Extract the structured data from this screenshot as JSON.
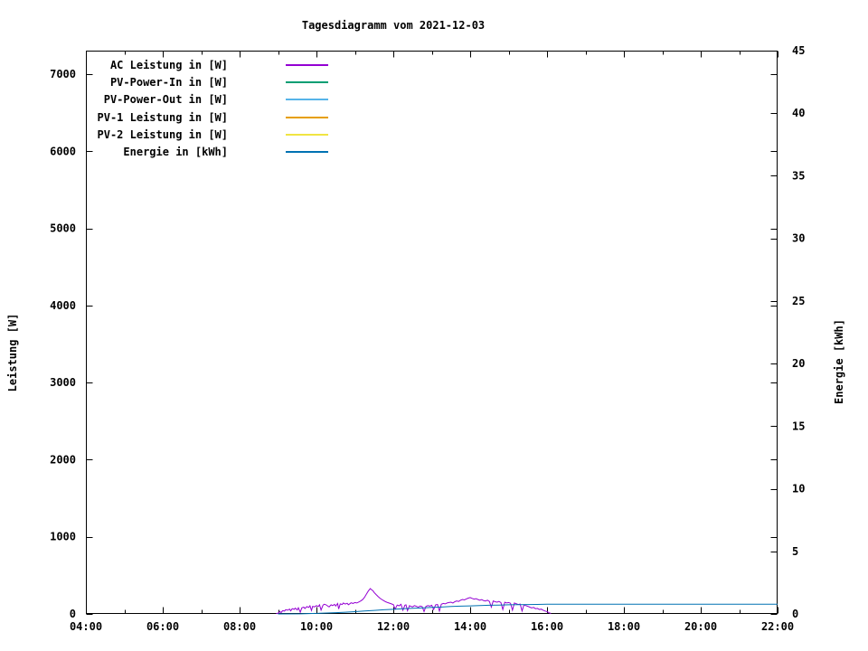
{
  "chart_data": {
    "type": "line",
    "title": "Tagesdiagramm vom 2021-12-03",
    "grid": false,
    "legend_position": "top-left-inside",
    "x_axis": {
      "range_hours": [
        4,
        22
      ],
      "major_ticks": [
        "04:00",
        "06:00",
        "08:00",
        "10:00",
        "12:00",
        "14:00",
        "16:00",
        "18:00",
        "20:00",
        "22:00"
      ],
      "minor_tick_hours": [
        5,
        7,
        9,
        11,
        13,
        15,
        17,
        19,
        21
      ]
    },
    "y_left": {
      "label": "Leistung [W]",
      "ticks": [
        0,
        1000,
        2000,
        3000,
        4000,
        5000,
        6000,
        7000
      ],
      "range": [
        0,
        7305
      ]
    },
    "y_right": {
      "label": "Energie [kWh]",
      "ticks": [
        0,
        5,
        10,
        15,
        20,
        25,
        30,
        35,
        40,
        45
      ],
      "range": [
        0,
        45
      ]
    },
    "axis_color": "#000000",
    "background_color": "#ffffff",
    "series": [
      {
        "name": "AC Leistung in [W]",
        "color": "#9400D3",
        "axis": "left",
        "points": [
          [
            8.95,
            5
          ],
          [
            9.0,
            8
          ],
          [
            9.05,
            30
          ],
          [
            9.08,
            18
          ],
          [
            9.12,
            42
          ],
          [
            9.17,
            38
          ],
          [
            9.2,
            55
          ],
          [
            9.25,
            48
          ],
          [
            9.3,
            62
          ],
          [
            9.33,
            40
          ],
          [
            9.37,
            68
          ],
          [
            9.42,
            60
          ],
          [
            9.45,
            75
          ],
          [
            9.5,
            52
          ],
          [
            9.53,
            80
          ],
          [
            9.58,
            22
          ],
          [
            9.62,
            78
          ],
          [
            9.67,
            88
          ],
          [
            9.7,
            70
          ],
          [
            9.75,
            95
          ],
          [
            9.8,
            85
          ],
          [
            9.83,
            105
          ],
          [
            9.87,
            45
          ],
          [
            9.9,
            98
          ],
          [
            9.95,
            92
          ],
          [
            10.0,
            108
          ],
          [
            10.05,
            96
          ],
          [
            10.08,
            118
          ],
          [
            10.12,
            50
          ],
          [
            10.17,
            112
          ],
          [
            10.2,
            126
          ],
          [
            10.25,
            118
          ],
          [
            10.3,
            100
          ],
          [
            10.33,
            92
          ],
          [
            10.38,
            118
          ],
          [
            10.42,
            108
          ],
          [
            10.47,
            124
          ],
          [
            10.5,
            102
          ],
          [
            10.55,
            135
          ],
          [
            10.58,
            65
          ],
          [
            10.62,
            130
          ],
          [
            10.67,
            122
          ],
          [
            10.7,
            142
          ],
          [
            10.75,
            128
          ],
          [
            10.8,
            138
          ],
          [
            10.83,
            120
          ],
          [
            10.87,
            132
          ],
          [
            10.9,
            144
          ],
          [
            10.95,
            136
          ],
          [
            11.0,
            148
          ],
          [
            11.05,
            142
          ],
          [
            11.1,
            155
          ],
          [
            11.15,
            168
          ],
          [
            11.2,
            185
          ],
          [
            11.25,
            215
          ],
          [
            11.3,
            258
          ],
          [
            11.35,
            298
          ],
          [
            11.4,
            328
          ],
          [
            11.43,
            315
          ],
          [
            11.47,
            300
          ],
          [
            11.5,
            278
          ],
          [
            11.55,
            252
          ],
          [
            11.6,
            228
          ],
          [
            11.65,
            205
          ],
          [
            11.7,
            188
          ],
          [
            11.75,
            172
          ],
          [
            11.8,
            158
          ],
          [
            11.85,
            148
          ],
          [
            11.9,
            140
          ],
          [
            11.95,
            130
          ],
          [
            12.0,
            122
          ],
          [
            12.05,
            62
          ],
          [
            12.1,
            115
          ],
          [
            12.15,
            105
          ],
          [
            12.2,
            125
          ],
          [
            12.25,
            48
          ],
          [
            12.3,
            112
          ],
          [
            12.33,
            118
          ],
          [
            12.37,
            42
          ],
          [
            12.42,
            108
          ],
          [
            12.45,
            100
          ],
          [
            12.5,
            92
          ],
          [
            12.55,
            108
          ],
          [
            12.6,
            98
          ],
          [
            12.65,
            88
          ],
          [
            12.7,
            102
          ],
          [
            12.75,
            95
          ],
          [
            12.8,
            32
          ],
          [
            12.85,
            98
          ],
          [
            12.9,
            108
          ],
          [
            12.95,
            102
          ],
          [
            13.0,
            112
          ],
          [
            13.05,
            58
          ],
          [
            13.1,
            118
          ],
          [
            13.15,
            122
          ],
          [
            13.2,
            38
          ],
          [
            13.25,
            126
          ],
          [
            13.3,
            136
          ],
          [
            13.35,
            130
          ],
          [
            13.4,
            142
          ],
          [
            13.45,
            148
          ],
          [
            13.5,
            152
          ],
          [
            13.55,
            142
          ],
          [
            13.6,
            158
          ],
          [
            13.65,
            168
          ],
          [
            13.7,
            162
          ],
          [
            13.75,
            178
          ],
          [
            13.8,
            188
          ],
          [
            13.85,
            182
          ],
          [
            13.9,
            195
          ],
          [
            13.95,
            205
          ],
          [
            14.0,
            212
          ],
          [
            14.05,
            202
          ],
          [
            14.1,
            192
          ],
          [
            14.15,
            198
          ],
          [
            14.2,
            188
          ],
          [
            14.25,
            178
          ],
          [
            14.3,
            185
          ],
          [
            14.35,
            172
          ],
          [
            14.4,
            168
          ],
          [
            14.45,
            178
          ],
          [
            14.5,
            162
          ],
          [
            14.55,
            88
          ],
          [
            14.6,
            168
          ],
          [
            14.65,
            158
          ],
          [
            14.7,
            152
          ],
          [
            14.75,
            162
          ],
          [
            14.8,
            148
          ],
          [
            14.85,
            58
          ],
          [
            14.9,
            152
          ],
          [
            14.95,
            142
          ],
          [
            15.0,
            148
          ],
          [
            15.05,
            138
          ],
          [
            15.1,
            48
          ],
          [
            15.15,
            142
          ],
          [
            15.2,
            132
          ],
          [
            15.25,
            122
          ],
          [
            15.3,
            128
          ],
          [
            15.35,
            38
          ],
          [
            15.4,
            118
          ],
          [
            15.45,
            108
          ],
          [
            15.5,
            98
          ],
          [
            15.55,
            88
          ],
          [
            15.6,
            78
          ],
          [
            15.65,
            84
          ],
          [
            15.7,
            68
          ],
          [
            15.75,
            72
          ],
          [
            15.8,
            58
          ],
          [
            15.85,
            62
          ],
          [
            15.9,
            48
          ],
          [
            15.95,
            38
          ],
          [
            16.0,
            30
          ],
          [
            16.05,
            15
          ],
          [
            16.1,
            6
          ]
        ]
      },
      {
        "name": "PV-Power-In in [W]",
        "color": "#009E73",
        "axis": "left",
        "points": []
      },
      {
        "name": "PV-Power-Out in [W]",
        "color": "#56B4E9",
        "axis": "left",
        "points": []
      },
      {
        "name": "PV-1 Leistung in [W]",
        "color": "#E69F00",
        "axis": "left",
        "points": []
      },
      {
        "name": "PV-2 Leistung in [W]",
        "color": "#F0E442",
        "axis": "left",
        "points": []
      },
      {
        "name": "Energie in [kWh]",
        "color": "#0072B2",
        "axis": "right",
        "points": [
          [
            9.0,
            0.0
          ],
          [
            9.6,
            0.01
          ],
          [
            10.0,
            0.04
          ],
          [
            10.25,
            0.07
          ],
          [
            10.5,
            0.1
          ],
          [
            10.75,
            0.14
          ],
          [
            11.0,
            0.18
          ],
          [
            11.25,
            0.23
          ],
          [
            11.5,
            0.28
          ],
          [
            11.75,
            0.33
          ],
          [
            12.0,
            0.37
          ],
          [
            12.25,
            0.41
          ],
          [
            12.5,
            0.45
          ],
          [
            12.75,
            0.48
          ],
          [
            13.0,
            0.52
          ],
          [
            13.25,
            0.55
          ],
          [
            13.5,
            0.59
          ],
          [
            13.75,
            0.62
          ],
          [
            14.0,
            0.64
          ],
          [
            14.25,
            0.67
          ],
          [
            14.5,
            0.69
          ],
          [
            14.75,
            0.71
          ],
          [
            15.0,
            0.73
          ],
          [
            15.25,
            0.74
          ],
          [
            15.5,
            0.75
          ],
          [
            15.75,
            0.76
          ],
          [
            16.0,
            0.77
          ],
          [
            22.0,
            0.77
          ]
        ]
      }
    ]
  }
}
